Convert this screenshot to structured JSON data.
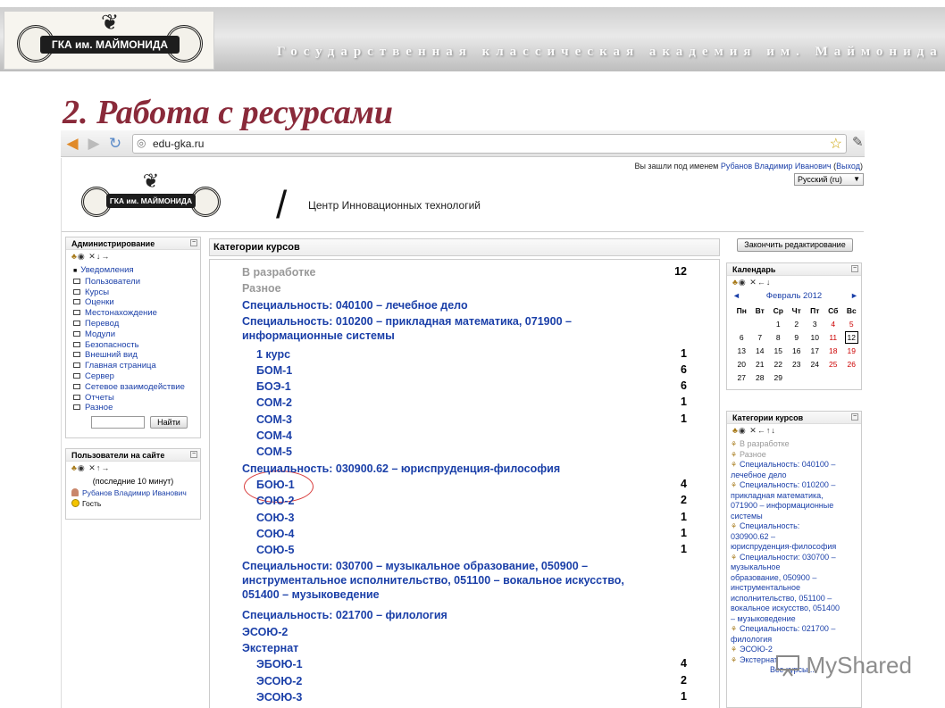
{
  "slide": {
    "banner_title": "Государственная классическая академия им. Маймонида",
    "heading": "2. Работа с ресурсами",
    "logo_text": "ГКА им. МАЙМОНИДА",
    "watermark": "MyShared"
  },
  "browser": {
    "url": "edu-gka.ru",
    "back_icon": "arrow-left-icon",
    "forward_icon": "arrow-right-icon",
    "reload_icon": "reload-icon"
  },
  "site": {
    "login_prefix": "Вы зашли под именем ",
    "user_name": "Рубанов Владимир Иванович",
    "logout_label": "Выход",
    "language": "Русский (ru)",
    "logo_text": "ГКА им. МАЙМОНИДА",
    "slash": "/",
    "name": "Центр Инновационных технологий"
  },
  "admin_block": {
    "title": "Администрирование",
    "edit_icons": "✕✚✖",
    "items": [
      {
        "label": "Уведомления",
        "type": "bullet"
      },
      {
        "label": "Пользователи",
        "type": "folder"
      },
      {
        "label": "Курсы",
        "type": "folder"
      },
      {
        "label": "Оценки",
        "type": "folder"
      },
      {
        "label": "Местонахождение",
        "type": "folder"
      },
      {
        "label": "Перевод",
        "type": "folder"
      },
      {
        "label": "Модули",
        "type": "folder"
      },
      {
        "label": "Безопасность",
        "type": "folder"
      },
      {
        "label": "Внешний вид",
        "type": "folder"
      },
      {
        "label": "Главная страница",
        "type": "folder"
      },
      {
        "label": "Сервер",
        "type": "folder"
      },
      {
        "label": "Сетевое взаимодействие",
        "type": "folder"
      },
      {
        "label": "Отчеты",
        "type": "folder"
      },
      {
        "label": "Разное",
        "type": "folder"
      }
    ],
    "search_button": "Найти"
  },
  "online_block": {
    "title": "Пользователи на сайте",
    "note": "(последние 10 минут)",
    "users": [
      "Рубанов Владимир Иванович",
      "Гость"
    ]
  },
  "main": {
    "heading": "Категории курсов",
    "finish_button": "Закончить редактирование",
    "categories": [
      {
        "label": "В разработке",
        "count": "12",
        "indent": 0,
        "hidden": true,
        "lines": 1
      },
      {
        "label": "Разное",
        "count": "",
        "indent": 0,
        "hidden": true,
        "lines": 1
      },
      {
        "label": "Специальность: 040100 – лечебное дело",
        "count": "",
        "indent": 0,
        "hidden": false,
        "lines": 1
      },
      {
        "label": "Специальность: 010200 – прикладная математика, 071900 –\nинформационные системы",
        "count": "",
        "indent": 0,
        "hidden": false,
        "lines": 2
      },
      {
        "label": "1 курс",
        "count": "1",
        "indent": 1,
        "hidden": false,
        "lines": 1
      },
      {
        "label": "БОМ-1",
        "count": "6",
        "indent": 1,
        "hidden": false,
        "lines": 1
      },
      {
        "label": "БОЭ-1",
        "count": "6",
        "indent": 1,
        "hidden": false,
        "lines": 1
      },
      {
        "label": "СОМ-2",
        "count": "1",
        "indent": 1,
        "hidden": false,
        "lines": 1
      },
      {
        "label": "СОМ-3",
        "count": "1",
        "indent": 1,
        "hidden": false,
        "lines": 1
      },
      {
        "label": "СОМ-4",
        "count": "",
        "indent": 1,
        "hidden": false,
        "lines": 1
      },
      {
        "label": "СОМ-5",
        "count": "",
        "indent": 1,
        "hidden": false,
        "lines": 1
      },
      {
        "label": "Специальность: 030900.62 – юриспруденция-философия",
        "count": "",
        "indent": 0,
        "hidden": false,
        "lines": 1
      },
      {
        "label": "БОЮ-1",
        "count": "4",
        "indent": 1,
        "hidden": false,
        "lines": 1
      },
      {
        "label": "СОЮ-2",
        "count": "2",
        "indent": 1,
        "hidden": false,
        "lines": 1
      },
      {
        "label": "СОЮ-3",
        "count": "1",
        "indent": 1,
        "hidden": false,
        "lines": 1
      },
      {
        "label": "СОЮ-4",
        "count": "1",
        "indent": 1,
        "hidden": false,
        "lines": 1
      },
      {
        "label": "СОЮ-5",
        "count": "1",
        "indent": 1,
        "hidden": false,
        "lines": 1
      },
      {
        "label": "Специальности: 030700 – музыкальное образование, 050900 –\nинструментальное исполнительство, 051100 – вокальное искусство,\n051400 – музыковедение",
        "count": "",
        "indent": 0,
        "hidden": false,
        "lines": 3
      },
      {
        "label": "Специальность: 021700 – филология",
        "count": "",
        "indent": 0,
        "hidden": false,
        "lines": 1
      },
      {
        "label": "ЭСОЮ-2",
        "count": "",
        "indent": 0,
        "hidden": false,
        "lines": 1
      },
      {
        "label": "Экстернат",
        "count": "",
        "indent": 0,
        "hidden": false,
        "lines": 1
      },
      {
        "label": "ЭБОЮ-1",
        "count": "4",
        "indent": 1,
        "hidden": false,
        "lines": 1
      },
      {
        "label": "ЭСОЮ-2",
        "count": "2",
        "indent": 1,
        "hidden": false,
        "lines": 1
      },
      {
        "label": "ЭСОЮ-3",
        "count": "1",
        "indent": 1,
        "hidden": false,
        "lines": 1
      }
    ]
  },
  "calendar": {
    "title": "Календарь",
    "month": "Февраль 2012",
    "prev": "◄",
    "next": "►",
    "days": [
      "Пн",
      "Вт",
      "Ср",
      "Чт",
      "Пт",
      "Сб",
      "Вс"
    ],
    "weeks": [
      [
        "",
        "",
        "1",
        "2",
        "3",
        "4",
        "5"
      ],
      [
        "6",
        "7",
        "8",
        "9",
        "10",
        "11",
        "12"
      ],
      [
        "13",
        "14",
        "15",
        "16",
        "17",
        "18",
        "19"
      ],
      [
        "20",
        "21",
        "22",
        "23",
        "24",
        "25",
        "26"
      ],
      [
        "27",
        "28",
        "29",
        "",
        "",
        "",
        ""
      ]
    ],
    "today": "12"
  },
  "cat_block": {
    "title": "Категории курсов",
    "items": [
      {
        "label": "В разработке",
        "hidden": true
      },
      {
        "label": "Разное",
        "hidden": true
      },
      {
        "label": "Специальность: 040100 –\nлечебное дело",
        "hidden": false
      },
      {
        "label": "Специальность: 010200 –\nприкладная математика,\n071900 – информационные\nсистемы",
        "hidden": false
      },
      {
        "label": "Специальность:\n030900.62 –\nюриспруденция-философия",
        "hidden": false
      },
      {
        "label": "Специальности: 030700 –\nмузыкальное\nобразование, 050900 –\nинструментальное\nисполнительство, 051100 –\nвокальное искусство, 051400\n– музыковедение",
        "hidden": false
      },
      {
        "label": "Специальность: 021700 –\nфилология",
        "hidden": false
      },
      {
        "label": "ЭСОЮ-2",
        "hidden": false
      },
      {
        "label": "Экстернат",
        "hidden": false
      }
    ],
    "all_courses": "Все курсы ..."
  }
}
